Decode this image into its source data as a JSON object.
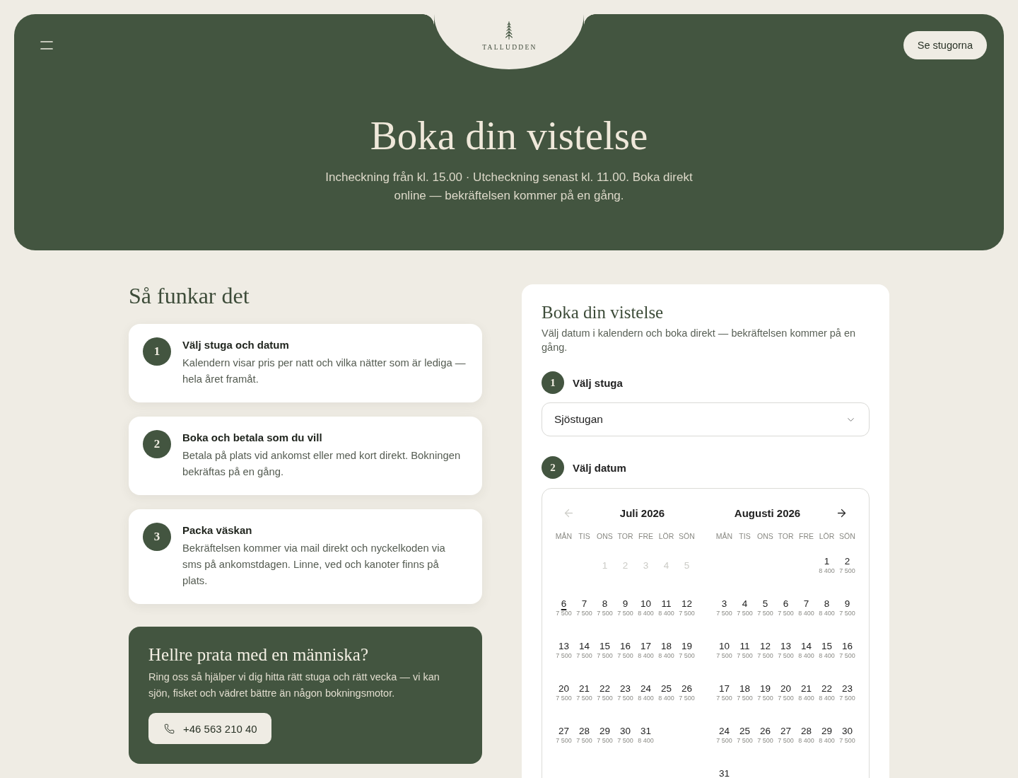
{
  "header": {
    "brand": "TALLUDDEN",
    "cta_button": "Se stugorna"
  },
  "hero": {
    "title": "Boka din vistelse",
    "subtitle": "Incheckning från kl. 15.00 · Utcheckning senast kl. 11.00. Boka direkt online — bekräftelsen kommer på en gång."
  },
  "how_it_works": {
    "title": "Så funkar det",
    "steps": [
      {
        "number": "1",
        "title": "Välj stuga och datum",
        "text": "Kalendern visar pris per natt och vilka nätter som är lediga — hela året framåt."
      },
      {
        "number": "2",
        "title": "Boka och betala som du vill",
        "text": "Betala på plats vid ankomst eller med kort direkt. Bokningen bekräftas på en gång."
      },
      {
        "number": "3",
        "title": "Packa väskan",
        "text": "Bekräftelsen kommer via mail direkt och nyckelkoden via sms på ankomstdagen. Linne, ved och kanoter finns på plats."
      }
    ]
  },
  "contact": {
    "title": "Hellre prata med en människa?",
    "text": "Ring oss så hjälper vi dig hitta rätt stuga och rätt vecka — vi kan sjön, fisket och vädret bättre än någon bokningsmotor.",
    "phone": "+46 563 210 40"
  },
  "booking": {
    "title": "Boka din vistelse",
    "subtitle": "Välj datum i kalendern och boka direkt — bekräftelsen kommer på en gång.",
    "steps": [
      {
        "number": "1",
        "label": "Välj stuga"
      },
      {
        "number": "2",
        "label": "Välj datum"
      }
    ],
    "cabin_select": {
      "value": "Sjöstugan"
    },
    "calendar": {
      "prev_button": {
        "disabled": true
      },
      "next_button": {
        "disabled": false
      },
      "months": [
        {
          "title": "Juli 2026",
          "weekdays": [
            "MÅN",
            "TIS",
            "ONS",
            "TOR",
            "FRE",
            "LÖR",
            "SÖN"
          ],
          "weeks": [
            {
              "days": [
                {
                  "day": "1",
                  "kind": "day",
                  "disabled": true
                },
                {
                  "day": "2",
                  "kind": "day",
                  "disabled": true
                },
                {
                  "day": "3",
                  "kind": "day",
                  "disabled": true
                },
                {
                  "day": "4",
                  "kind": "day",
                  "disabled": true
                },
                {
                  "day": "5",
                  "kind": "day",
                  "disabled": true
                }
              ]
            },
            {
              "days": [
                {
                  "day": "6",
                  "price": "7 500",
                  "kind": "today",
                  "disabled": false
                },
                {
                  "day": "7",
                  "price": "7 500",
                  "kind": "day",
                  "disabled": false
                },
                {
                  "day": "8",
                  "price": "7 500",
                  "kind": "day",
                  "disabled": false
                },
                {
                  "day": "9",
                  "price": "7 500",
                  "kind": "day",
                  "disabled": false
                },
                {
                  "day": "10",
                  "price": "8 400",
                  "kind": "day",
                  "disabled": false
                },
                {
                  "day": "11",
                  "price": "8 400",
                  "kind": "day",
                  "disabled": false
                },
                {
                  "day": "12",
                  "price": "7 500",
                  "kind": "day",
                  "disabled": false
                }
              ]
            },
            {
              "days": [
                {
                  "day": "13",
                  "price": "7 500",
                  "kind": "day",
                  "disabled": false
                },
                {
                  "day": "14",
                  "price": "7 500",
                  "kind": "day",
                  "disabled": false
                },
                {
                  "day": "15",
                  "price": "7 500",
                  "kind": "day",
                  "disabled": false
                },
                {
                  "day": "16",
                  "price": "7 500",
                  "kind": "day",
                  "disabled": false
                },
                {
                  "day": "17",
                  "price": "8 400",
                  "kind": "day",
                  "disabled": false
                },
                {
                  "day": "18",
                  "price": "8 400",
                  "kind": "day",
                  "disabled": false
                },
                {
                  "day": "19",
                  "price": "7 500",
                  "kind": "day",
                  "disabled": false
                }
              ]
            },
            {
              "days": [
                {
                  "day": "20",
                  "price": "7 500",
                  "kind": "day",
                  "disabled": false
                },
                {
                  "day": "21",
                  "price": "7 500",
                  "kind": "day",
                  "disabled": false
                },
                {
                  "day": "22",
                  "price": "7 500",
                  "kind": "day",
                  "disabled": false
                },
                {
                  "day": "23",
                  "price": "7 500",
                  "kind": "day",
                  "disabled": false
                },
                {
                  "day": "24",
                  "price": "8 400",
                  "kind": "day",
                  "disabled": false
                },
                {
                  "day": "25",
                  "price": "8 400",
                  "kind": "day",
                  "disabled": false
                },
                {
                  "day": "26",
                  "price": "7 500",
                  "kind": "day",
                  "disabled": false
                }
              ]
            },
            {
              "days": [
                {
                  "day": "27",
                  "price": "7 500",
                  "kind": "day",
                  "disabled": false
                },
                {
                  "day": "28",
                  "price": "7 500",
                  "kind": "day",
                  "disabled": false
                },
                {
                  "day": "29",
                  "price": "7 500",
                  "kind": "day",
                  "disabled": false
                },
                {
                  "day": "30",
                  "price": "7 500",
                  "kind": "day",
                  "disabled": false
                },
                {
                  "day": "31",
                  "price": "8 400",
                  "kind": "day",
                  "disabled": false
                }
              ]
            }
          ]
        },
        {
          "title": "Augusti 2026",
          "weekdays": [
            "MÅN",
            "TIS",
            "ONS",
            "TOR",
            "FRE",
            "LÖR",
            "SÖN"
          ],
          "weeks": [
            {
              "days": [
                {
                  "day": "1",
                  "price": "8 400",
                  "kind": "day",
                  "disabled": false
                },
                {
                  "day": "2",
                  "price": "7 500",
                  "kind": "day",
                  "disabled": false
                }
              ]
            },
            {
              "days": [
                {
                  "day": "3",
                  "price": "7 500",
                  "kind": "day",
                  "disabled": false
                },
                {
                  "day": "4",
                  "price": "7 500",
                  "kind": "day",
                  "disabled": false
                },
                {
                  "day": "5",
                  "price": "7 500",
                  "kind": "day",
                  "disabled": false
                },
                {
                  "day": "6",
                  "price": "7 500",
                  "kind": "day",
                  "disabled": false
                },
                {
                  "day": "7",
                  "price": "8 400",
                  "kind": "day",
                  "disabled": false
                },
                {
                  "day": "8",
                  "price": "8 400",
                  "kind": "day",
                  "disabled": false
                },
                {
                  "day": "9",
                  "price": "7 500",
                  "kind": "day",
                  "disabled": false
                }
              ]
            },
            {
              "days": [
                {
                  "day": "10",
                  "price": "7 500",
                  "kind": "day",
                  "disabled": false
                },
                {
                  "day": "11",
                  "price": "7 500",
                  "kind": "day",
                  "disabled": false
                },
                {
                  "day": "12",
                  "price": "7 500",
                  "kind": "day",
                  "disabled": false
                },
                {
                  "day": "13",
                  "price": "7 500",
                  "kind": "day",
                  "disabled": false
                },
                {
                  "day": "14",
                  "price": "8 400",
                  "kind": "day",
                  "disabled": false
                },
                {
                  "day": "15",
                  "price": "8 400",
                  "kind": "day",
                  "disabled": false
                },
                {
                  "day": "16",
                  "price": "7 500",
                  "kind": "day",
                  "disabled": false
                }
              ]
            },
            {
              "days": [
                {
                  "day": "17",
                  "price": "7 500",
                  "kind": "day",
                  "disabled": false
                },
                {
                  "day": "18",
                  "price": "7 500",
                  "kind": "day",
                  "disabled": false
                },
                {
                  "day": "19",
                  "price": "7 500",
                  "kind": "day",
                  "disabled": false
                },
                {
                  "day": "20",
                  "price": "7 500",
                  "kind": "day",
                  "disabled": false
                },
                {
                  "day": "21",
                  "price": "8 400",
                  "kind": "day",
                  "disabled": false
                },
                {
                  "day": "22",
                  "price": "8 400",
                  "kind": "day",
                  "disabled": false
                },
                {
                  "day": "23",
                  "price": "7 500",
                  "kind": "day",
                  "disabled": false
                }
              ]
            },
            {
              "days": [
                {
                  "day": "24",
                  "price": "7 500",
                  "kind": "day",
                  "disabled": false
                },
                {
                  "day": "25",
                  "price": "7 500",
                  "kind": "day",
                  "disabled": false
                },
                {
                  "day": "26",
                  "price": "7 500",
                  "kind": "day",
                  "disabled": false
                },
                {
                  "day": "27",
                  "price": "7 500",
                  "kind": "day",
                  "disabled": false
                },
                {
                  "day": "28",
                  "price": "8 400",
                  "kind": "day",
                  "disabled": false
                },
                {
                  "day": "29",
                  "price": "8 400",
                  "kind": "day",
                  "disabled": false
                },
                {
                  "day": "30",
                  "price": "7 500",
                  "kind": "day",
                  "disabled": false
                }
              ]
            },
            {
              "days": [
                {
                  "day": "31",
                  "kind": "day",
                  "disabled": false
                }
              ]
            }
          ]
        }
      ]
    }
  }
}
